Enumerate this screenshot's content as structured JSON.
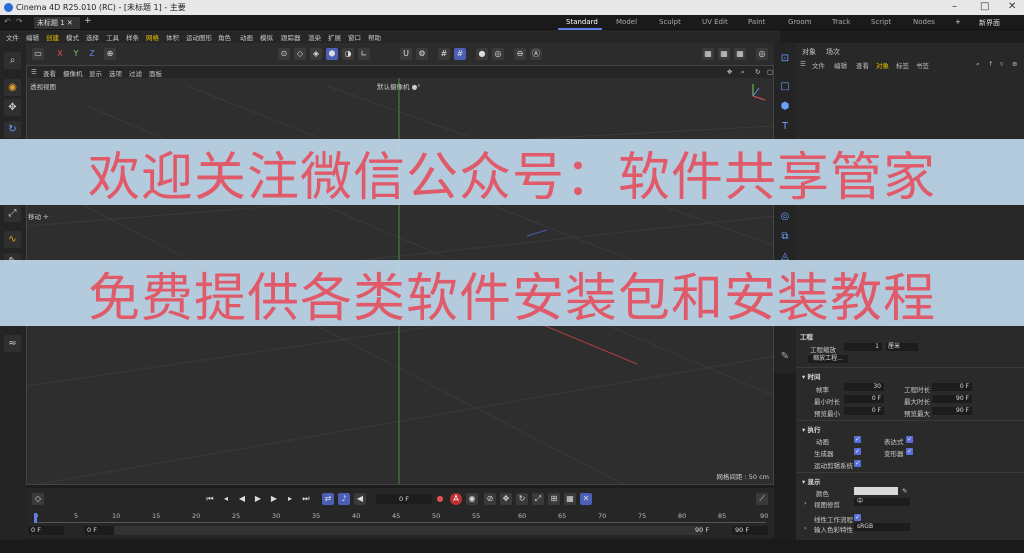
{
  "titlebar": {
    "title": "Cinema 4D R25.010 (RC) - [未标题 1] - 主要"
  },
  "tabs": {
    "document": "未标题 1",
    "layouts": [
      "Standard",
      "Model",
      "Sculpt",
      "UV Edit",
      "Paint",
      "Groom",
      "Track",
      "Script",
      "Nodes"
    ],
    "new_layout": "新界面"
  },
  "menu": [
    "文件",
    "编辑",
    "创建",
    "模式",
    "选择",
    "工具",
    "样条",
    "网格",
    "体积",
    "运动图形",
    "角色",
    "动画",
    "模拟",
    "跟踪器",
    "渲染",
    "扩展",
    "窗口",
    "帮助"
  ],
  "viewport": {
    "menu": [
      "查看",
      "摄像机",
      "显示",
      "选项",
      "过滤",
      "面板"
    ],
    "view_name": "透视视图",
    "camera": "默认摄像机 ●°",
    "tool": "移动 ✛",
    "grid_spacing": "网格间距 : 50 cm"
  },
  "toolbar_axes": [
    "X",
    "Y",
    "Z"
  ],
  "object_manager": {
    "tabs": [
      "对象",
      "场次"
    ],
    "menu": [
      "文件",
      "编辑",
      "查看",
      "对象",
      "标签",
      "书签"
    ]
  },
  "attributes": {
    "section_title": "工程",
    "scale_label": "工程缩放",
    "scale_value": "1",
    "scale_unit": "厘米",
    "scale_button": "缩放工程...",
    "time": {
      "header": "时间",
      "fps_label": "帧率",
      "fps_value": "30",
      "project_time_label": "工程时长",
      "project_time_value": "0 F",
      "min_label": "最小时长",
      "min_value": "0 F",
      "max_label": "最大时长",
      "max_value": "90 F",
      "preview_min_label": "预览最小",
      "preview_min_value": "0 F",
      "preview_max_label": "预览最大",
      "preview_max_value": "90 F"
    },
    "exec": {
      "header": "执行",
      "animation": "动画",
      "expression": "表达式",
      "generators": "生成器",
      "deformers": "变形器",
      "motion_system": "运动剪辑系统"
    },
    "display": {
      "header": "显示",
      "color_label": "颜色",
      "lod_label": "视图修剪",
      "lod_value": "中",
      "linear": "线性工作流程",
      "input_color": "输入色彩特性",
      "input_color_value": "sRGB"
    }
  },
  "timeline": {
    "current_frame": "0 F",
    "ticks": [
      "0",
      "5",
      "10",
      "15",
      "20",
      "25",
      "30",
      "35",
      "40",
      "45",
      "50",
      "55",
      "60",
      "65",
      "70",
      "75",
      "80",
      "85",
      "90"
    ],
    "start": "0 F",
    "start2": "0 F",
    "end": "90 F",
    "end2": "90 F"
  },
  "overlay": {
    "line1": "欢迎关注微信公众号：软件共享管家",
    "line2": "免费提供各类软件安装包和安装教程",
    "color": "#e05a6a",
    "bg": "#bed7eb"
  }
}
